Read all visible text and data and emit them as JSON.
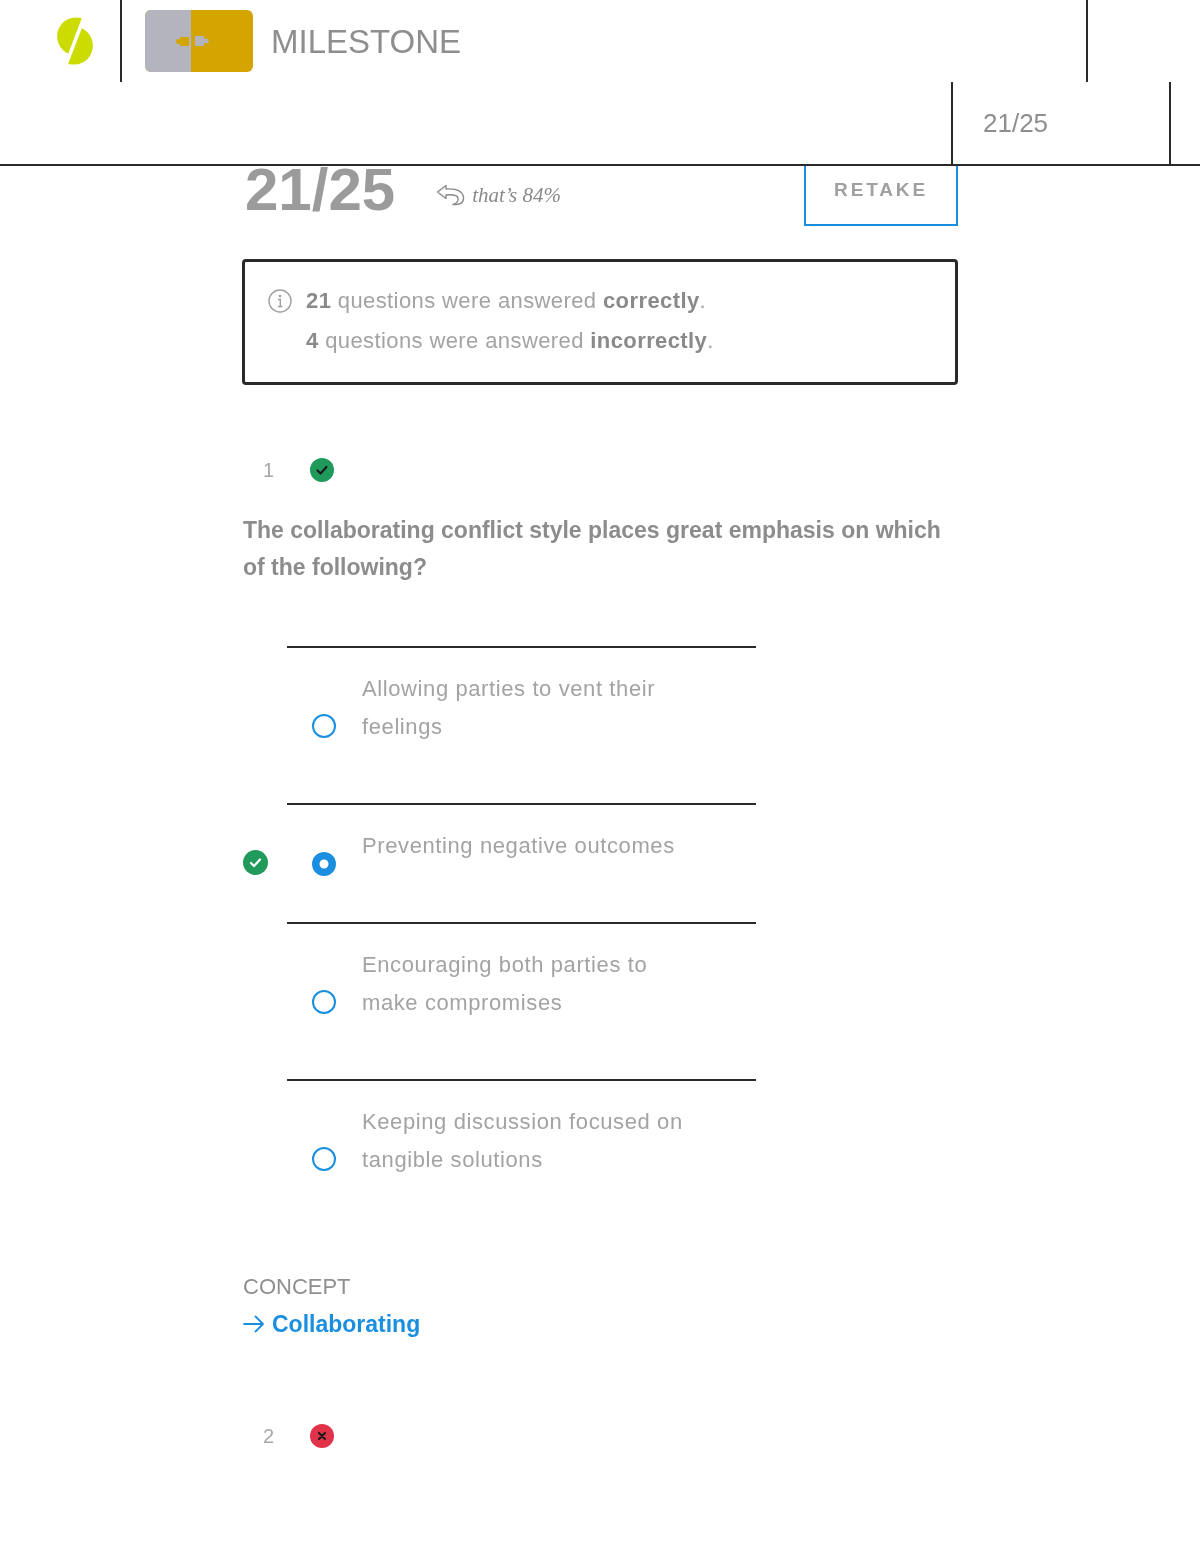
{
  "header": {
    "title": "MILESTONE",
    "score": "21/25"
  },
  "result": {
    "score": "21/25",
    "note": "that’s 84%",
    "retake_label": "RETAKE"
  },
  "summary": [
    "**21** questions were answered **correctly**.",
    "**4** questions were answered **incorrectly**."
  ],
  "questions": [
    {
      "number": "1",
      "correct": true,
      "text": "The collaborating conflict style places great emphasis on which of the following?",
      "options": [
        {
          "text": "Allowing parties to vent their feelings",
          "selected": false,
          "correct": false
        },
        {
          "text": "Preventing negative outcomes",
          "selected": true,
          "correct": true
        },
        {
          "text": "Encouraging both parties to make compromises",
          "selected": false,
          "correct": false
        },
        {
          "text": "Keeping discussion focused on tangible solutions",
          "selected": false,
          "correct": false
        }
      ],
      "concept": {
        "label": "CONCEPT",
        "link": "Collaborating"
      }
    },
    {
      "number": "2",
      "correct": false
    }
  ]
}
